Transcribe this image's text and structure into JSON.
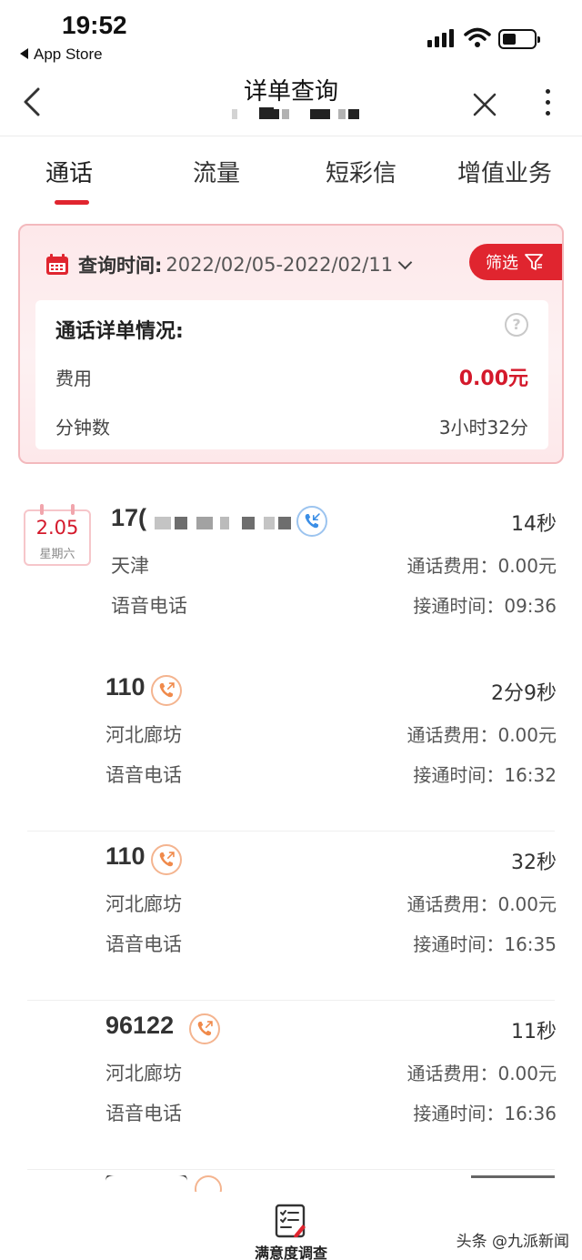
{
  "status_bar": {
    "time": "19:52",
    "back_app": "App Store"
  },
  "nav": {
    "title": "详单查询"
  },
  "tabs": [
    {
      "label": "通话",
      "active": true
    },
    {
      "label": "流量",
      "active": false
    },
    {
      "label": "短彩信",
      "active": false
    },
    {
      "label": "增值业务",
      "active": false
    }
  ],
  "summary": {
    "query_label": "查询时间:",
    "query_range": "2022/02/05-2022/02/11",
    "filter_label": "筛选",
    "detail_title": "通话详单情况:",
    "fee_label": "费用",
    "fee_value": "0.00元",
    "minutes_label": "分钟数",
    "minutes_value": "3小时32分"
  },
  "date_badge": {
    "day": "2.05",
    "weekday": "星期六"
  },
  "calls": [
    {
      "number": "17(",
      "direction": "incoming",
      "duration": "14秒",
      "location": "天津",
      "type": "语音电话",
      "fee": "通话费用：0.00元",
      "time": "接通时间：09:36"
    },
    {
      "number": "110",
      "direction": "outgoing",
      "duration": "2分9秒",
      "location": "河北廊坊",
      "type": "语音电话",
      "fee": "通话费用：0.00元",
      "time": "接通时间：16:32"
    },
    {
      "number": "110",
      "direction": "outgoing",
      "duration": "32秒",
      "location": "河北廊坊",
      "type": "语音电话",
      "fee": "通话费用：0.00元",
      "time": "接通时间：16:35"
    },
    {
      "number": "96122",
      "direction": "outgoing",
      "duration": "11秒",
      "location": "河北廊坊",
      "type": "语音电话",
      "fee": "通话费用：0.00元",
      "time": "接通时间：16:36"
    }
  ],
  "bottom": {
    "survey_label": "满意度调查",
    "watermark": "头条 @九派新闻"
  },
  "colors": {
    "accent": "#e0252f",
    "fee_red": "#d4192b",
    "card_border": "#f3b9bd",
    "outgoing_icon": "#f08a4b",
    "incoming_icon": "#3a8ee6"
  },
  "icons": [
    "back-chevron",
    "close-x",
    "more-vertical",
    "calendar",
    "filter-funnel",
    "help-circle",
    "phone-incoming",
    "phone-outgoing",
    "survey-clipboard"
  ]
}
